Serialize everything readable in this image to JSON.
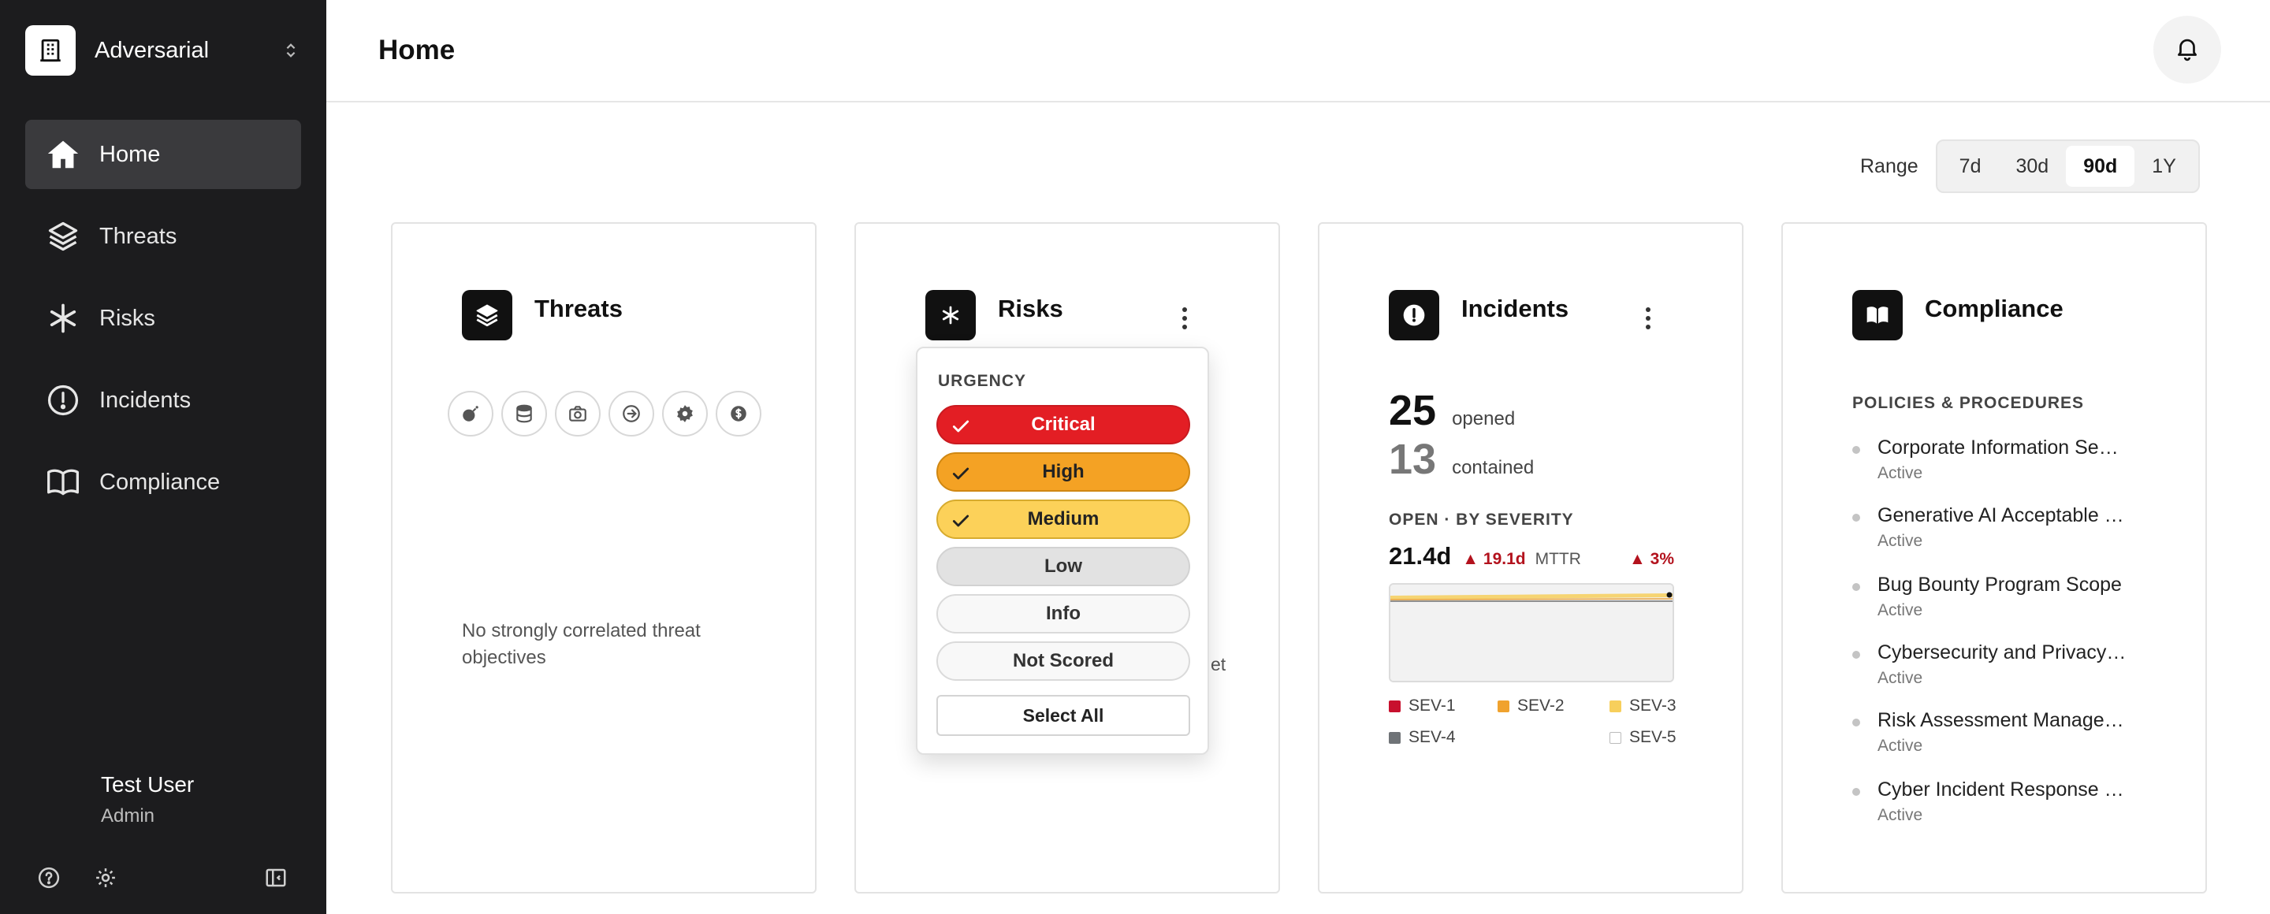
{
  "org": {
    "name": "Adversarial"
  },
  "nav": {
    "items": [
      {
        "label": "Home",
        "icon": "home-icon",
        "active": true
      },
      {
        "label": "Threats",
        "icon": "layers-icon",
        "active": false
      },
      {
        "label": "Risks",
        "icon": "asterisk-icon",
        "active": false
      },
      {
        "label": "Incidents",
        "icon": "alert-circle-icon",
        "active": false
      },
      {
        "label": "Compliance",
        "icon": "book-icon",
        "active": false
      }
    ]
  },
  "user": {
    "name": "Test User",
    "role": "Admin"
  },
  "header": {
    "title": "Home"
  },
  "range": {
    "label": "Range",
    "options": [
      "7d",
      "30d",
      "90d",
      "1Y"
    ],
    "selected": "90d"
  },
  "cards": {
    "threats": {
      "title": "Threats",
      "objective_icons": [
        "bomb-icon",
        "database-icon",
        "camera-icon",
        "arrow-right-circle-icon",
        "settings-icon",
        "dollar-icon"
      ],
      "empty": "No strongly correlated threat objectives"
    },
    "risks": {
      "title": "Risks",
      "behind_text": "et",
      "dropdown": {
        "title": "URGENCY",
        "options": [
          {
            "label": "Critical",
            "checked": true
          },
          {
            "label": "High",
            "checked": true
          },
          {
            "label": "Medium",
            "checked": true
          },
          {
            "label": "Low",
            "checked": false
          },
          {
            "label": "Info",
            "checked": false
          },
          {
            "label": "Not Scored",
            "checked": false
          }
        ],
        "select_all": "Select All"
      }
    },
    "incidents": {
      "title": "Incidents",
      "opened": {
        "value": "25",
        "label": "opened"
      },
      "contained": {
        "value": "13",
        "label": "contained"
      },
      "severity_title": "OPEN · BY SEVERITY",
      "mttr": {
        "value": "21.4d",
        "delta": "▲ 19.1d",
        "label": "MTTR",
        "pct": "▲ 3%"
      },
      "legend": [
        {
          "label": "SEV-1",
          "color": "#c8102e"
        },
        {
          "label": "SEV-2",
          "color": "#f0a22e"
        },
        {
          "label": "SEV-3",
          "color": "#f7cf5c"
        },
        {
          "label": "SEV-4",
          "color": "#6f7377"
        },
        {
          "label": "SEV-5",
          "color": "#ffffff"
        }
      ]
    },
    "compliance": {
      "title": "Compliance",
      "section": "POLICIES & PROCEDURES",
      "policies": [
        {
          "name": "Corporate Information Se…",
          "status": "Active"
        },
        {
          "name": "Generative AI Acceptable …",
          "status": "Active"
        },
        {
          "name": "Bug Bounty Program Scope",
          "status": "Active"
        },
        {
          "name": "Cybersecurity and Privacy…",
          "status": "Active"
        },
        {
          "name": "Risk Assessment Manage…",
          "status": "Active"
        },
        {
          "name": "Cyber Incident Response …",
          "status": "Active"
        }
      ]
    }
  }
}
